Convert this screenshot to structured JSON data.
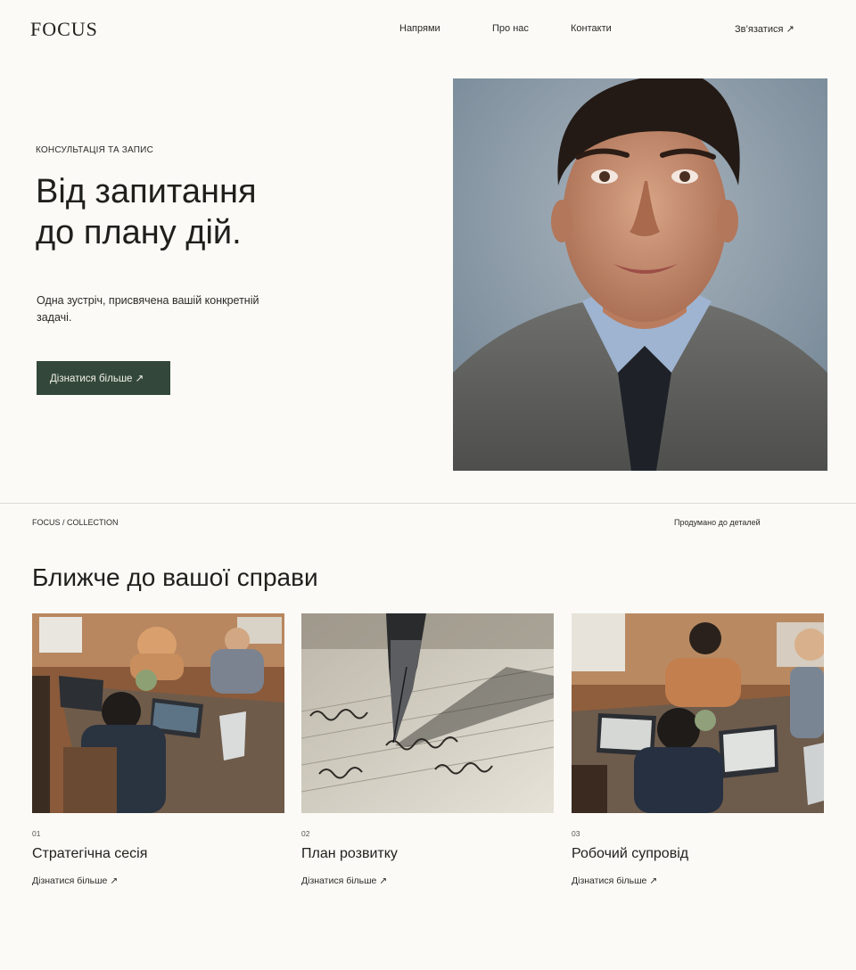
{
  "header": {
    "logo": "FOCUS",
    "nav": [
      "Напрями",
      "Про нас",
      "Контакти"
    ],
    "contact": "Зв’язатися ↗"
  },
  "hero": {
    "eyebrow": "КОНСУЛЬТАЦІЯ ТА ЗАПИС",
    "title_line1": "Від запитання",
    "title_line2": "до плану дій.",
    "text": "Одна зустріч, присвячена вашій конкретній задачі.",
    "cta": "Дізнатися більше ↗"
  },
  "collection": {
    "label": "FOCUS / COLLECTION",
    "tagline": "Продумано до деталей",
    "title": "Ближче до вашої справи",
    "cards": [
      {
        "num": "01",
        "title": "Стратегічна сесія",
        "link": "Дізнатися більше ↗"
      },
      {
        "num": "02",
        "title": "План розвитку",
        "link": "Дізнатися більше ↗"
      },
      {
        "num": "03",
        "title": "Робочий супровід",
        "link": "Дізнатися більше ↗"
      }
    ]
  },
  "colors": {
    "background": "#fbfaf6",
    "accent": "#33483a",
    "text": "#1f1f1c"
  }
}
